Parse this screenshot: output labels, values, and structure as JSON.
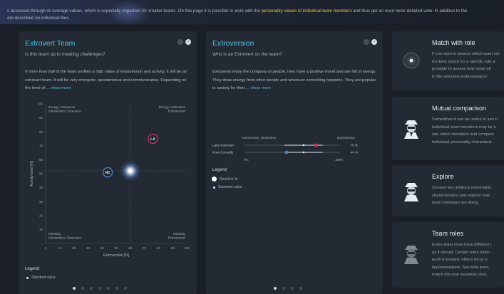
{
  "intro": {
    "line1_part1": "s assessed through its average values, which is especially important for smaller teams. On this page it is possible to work with the ",
    "line1_highlight": "personality values of individual team members",
    "line1_part2": " and thus get an even more detailed view. In addition to the",
    "line2": "are described on individual tiles."
  },
  "extrovert_team": {
    "title": "Extrovert Team",
    "subtitle": "Is this team up to meeting challenges?",
    "description": "If more than half of the team profiles a high value of extraversion and activity, it will be an extrovert team. It will be very energetic, spontaneous and communicative. Depending on the level of ...",
    "show_more": "show more",
    "legend_title": "Legend",
    "legend_standard": "Standard value",
    "chart_data": {
      "type": "scatter",
      "xlabel": "Extroversion [%]",
      "ylabel": "Activity level [%]",
      "xlim": [
        0,
        100
      ],
      "ylim": [
        0,
        100
      ],
      "x_ticks": [
        "0",
        "10",
        "20",
        "30",
        "40",
        "50",
        "60",
        "70",
        "80",
        "90",
        "100"
      ],
      "y_ticks": [
        "10",
        "20",
        "30",
        "40",
        "50",
        "60",
        "70",
        "80",
        "90",
        "100"
      ],
      "reference_lines": {
        "x": 60,
        "y": 52
      },
      "quadrant_labels": {
        "top_left": [
          "Energy, Activeness",
          "Introversion, Closeness"
        ],
        "top_right": [
          "Energy, Activeness",
          "Extroversion"
        ],
        "bottom_left": [
          "Passivity",
          "Introversion, Closeness"
        ],
        "bottom_right": [
          "Passivity",
          "Extroversion"
        ]
      },
      "points": [
        {
          "label": "LA",
          "x": 76,
          "y": 75,
          "color": "#c73a5a"
        },
        {
          "label": "NC",
          "x": 44,
          "y": 51,
          "color": "#4a88c8"
        }
      ],
      "standard_value": {
        "x": 60,
        "y": 52
      }
    }
  },
  "extroversion": {
    "title": "Extroversion",
    "subtitle": "Who is an Extrovert on the team?",
    "description": "Extroverts enjoy the company of people, they have a positive mood and are full of energy. They draw energy from other people and wherever something happens. They are popular in society for their ...",
    "show_more": "show more",
    "legend_title": "Legend",
    "legend_result": "Result in %",
    "legend_standard": "Standard value",
    "chart_data": {
      "type": "bar",
      "left_label": "Introversion, Closeness",
      "right_label": "Extroversion",
      "min_label": "0%",
      "max_label": "100%",
      "rows": [
        {
          "name": "Lara Andersen",
          "value": 75,
          "label": "75 %",
          "color": "#c73a5a"
        },
        {
          "name": "Nora Connolly",
          "value": 44,
          "label": "44 %",
          "color": "#4a88c8"
        }
      ],
      "standard_value": 62
    }
  },
  "tiles": [
    {
      "title": "Match with role",
      "text": [
        "If you want to assess which team me",
        "the best match for a specific role a",
        "possible to assess how close all",
        "to the selected professional pr"
      ]
    },
    {
      "title": "Mutual comparison",
      "text": [
        "Sometimes it can be useful to see h",
        "individual team members may be s",
        "can select members and compare",
        "individual personality characteris"
      ]
    },
    {
      "title": "Explore",
      "text": [
        "Choose two arbitrary personality",
        "characteristics and explore how",
        "team members are doing."
      ]
    },
    {
      "title": "Team roles",
      "text": [
        "Every team must have different r",
        "as it should. Certain roles motiv",
        "push it forward, others focus o",
        "implementation. See how team",
        "match the nine essential roles"
      ]
    }
  ]
}
